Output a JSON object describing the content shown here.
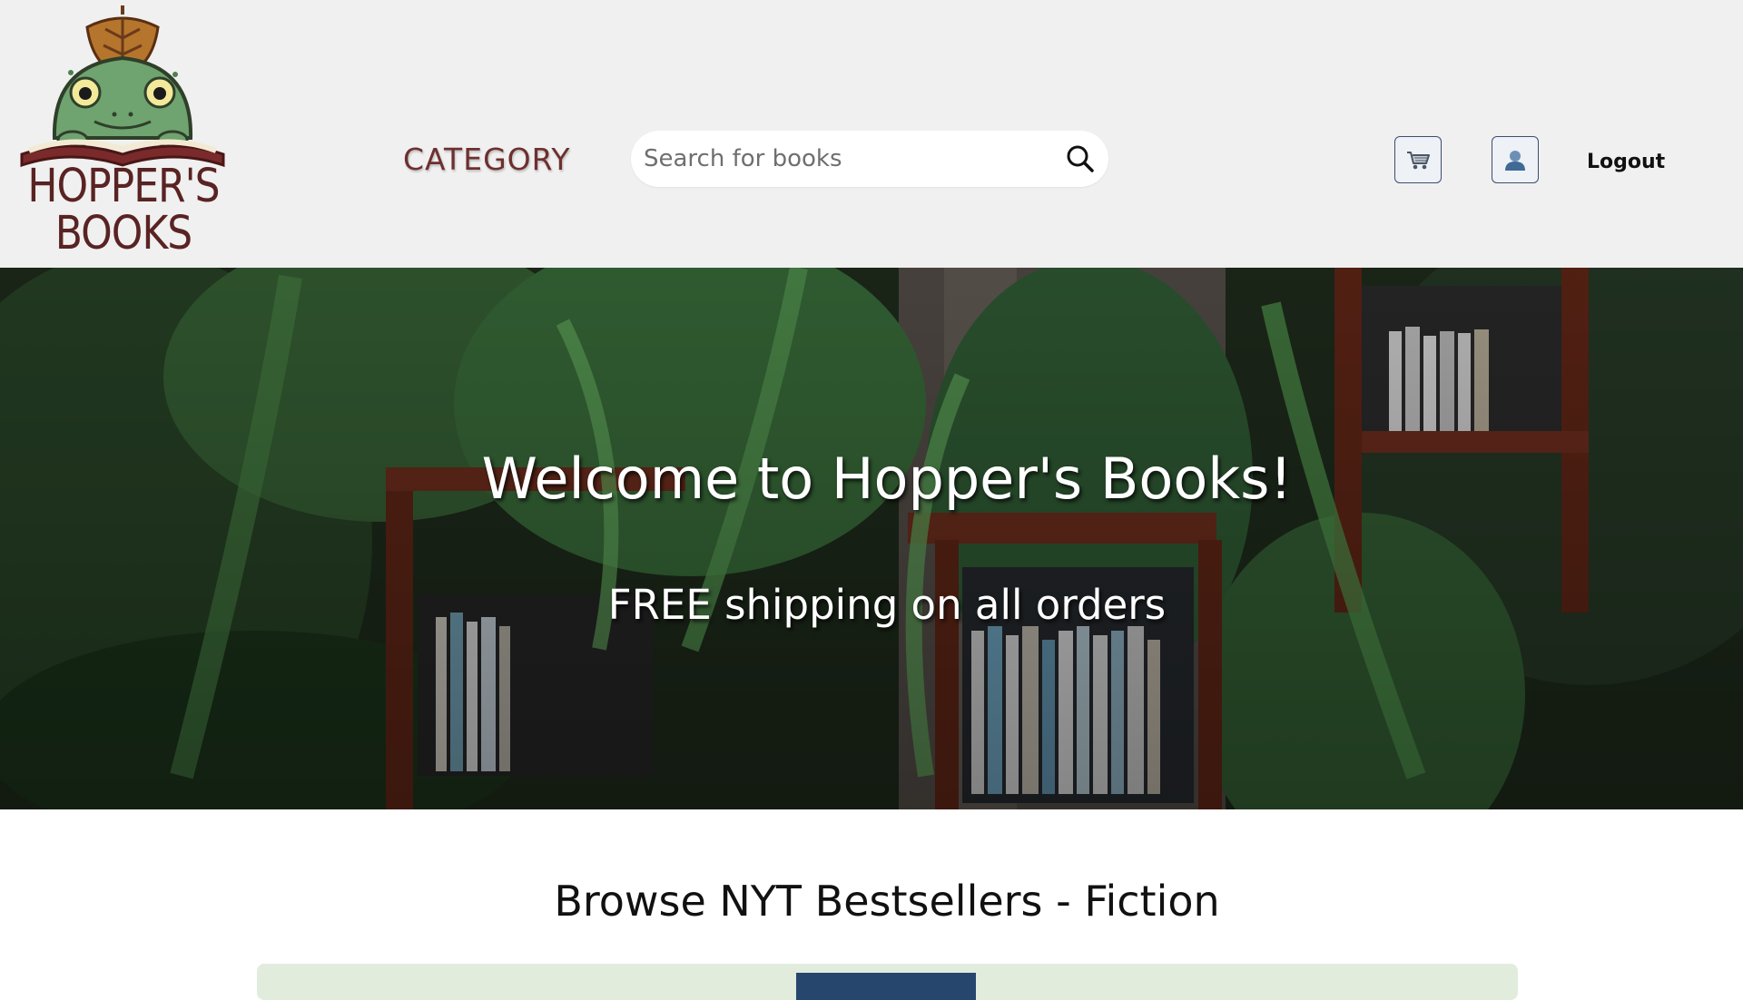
{
  "header": {
    "logo": {
      "line1": "HOPPER'S",
      "line2": "BOOKS"
    },
    "category_label": "CATEGORY",
    "search": {
      "placeholder": "Search for books",
      "value": "",
      "icon": "search-icon"
    },
    "cart_icon": "cart-icon",
    "user_icon": "user-icon",
    "logout_label": "Logout"
  },
  "hero": {
    "title": "Welcome to Hopper's Books!",
    "subtitle": "FREE shipping on all orders"
  },
  "browse": {
    "title": "Browse NYT Bestsellers - Fiction"
  },
  "colors": {
    "header_bg": "#f0f0f0",
    "category_text": "#6e2f2f",
    "logo_brown": "#5a2323",
    "frog_green": "#6fa36f",
    "carousel_bg": "#e1ecdd",
    "carousel_indicator": "#27466e"
  }
}
